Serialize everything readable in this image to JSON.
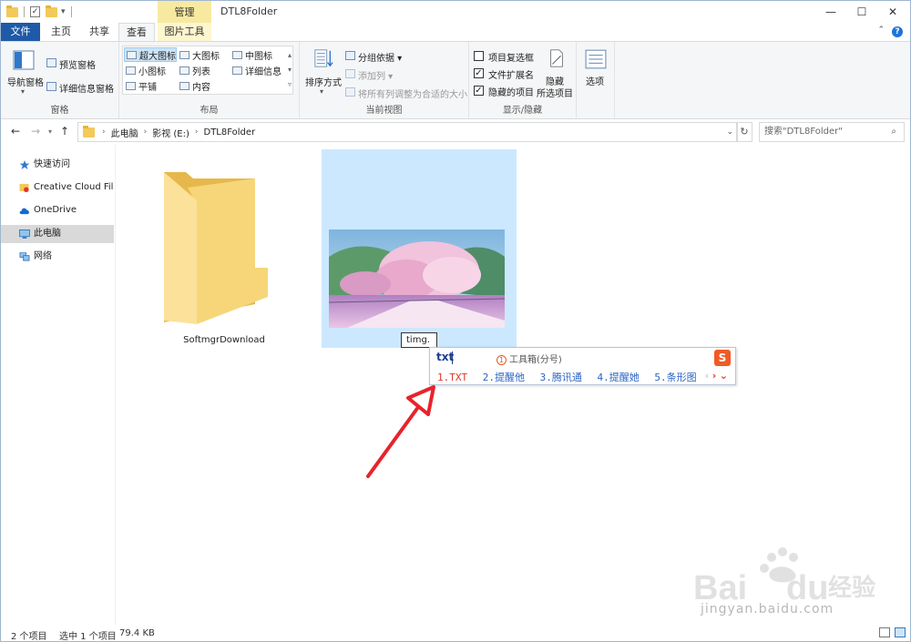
{
  "titlebar": {
    "context_tab": "管理",
    "title": "DTL8Folder",
    "minimize": "—",
    "maximize": "☐",
    "close": "✕"
  },
  "tabs": {
    "file": "文件",
    "home": "主页",
    "share": "共享",
    "view": "查看",
    "picture_tools": "图片工具"
  },
  "ribbon": {
    "panes": {
      "title": "窗格",
      "nav_pane": "导航窗格",
      "preview": "预览窗格",
      "details": "详细信息窗格"
    },
    "layout": {
      "title": "布局",
      "items": [
        "超大图标",
        "大图标",
        "中图标",
        "小图标",
        "列表",
        "详细信息",
        "平铺",
        "内容"
      ]
    },
    "current_view": {
      "title": "当前视图",
      "sort": "排序方式",
      "group_by": "分组依据",
      "add_column": "添加列",
      "fit_columns": "将所有列调整为合适的大小"
    },
    "show_hide": {
      "title": "显示/隐藏",
      "item_checkboxes": "项目复选框",
      "extensions": "文件扩展名",
      "hidden_items": "隐藏的项目",
      "hide_selected_1": "隐藏",
      "hide_selected_2": "所选项目",
      "options": "选项"
    }
  },
  "address": {
    "crumbs": [
      "此电脑",
      "影视 (E:)",
      "DTL8Folder"
    ],
    "search_placeholder": "搜索\"DTL8Folder\""
  },
  "nav_pane": {
    "items": [
      "快速访问",
      "Creative Cloud Files",
      "OneDrive",
      "此电脑",
      "网络"
    ]
  },
  "files": {
    "folder_name": "SoftmgrDownload",
    "rename_value": "timg."
  },
  "ime": {
    "input": "txt",
    "hint_num": "1",
    "hint": "工具箱(分号)",
    "logo": "S",
    "candidates": [
      "1.TXT",
      "2.提醒他",
      "3.腾讯通",
      "4.提醒她",
      "5.条形图"
    ],
    "prev": "‹",
    "next": "›",
    "expand": "⌄"
  },
  "status": {
    "count": "2 个项目",
    "selected": "选中 1 个项目",
    "size": "79.4 KB"
  },
  "watermark": {
    "url": "jingyan.baidu.com"
  },
  "colors": {
    "file_tab": "#1e5aa8",
    "context_tab": "#f7eaa0",
    "selection": "#cce8ff",
    "arrow": "#e8232b"
  }
}
